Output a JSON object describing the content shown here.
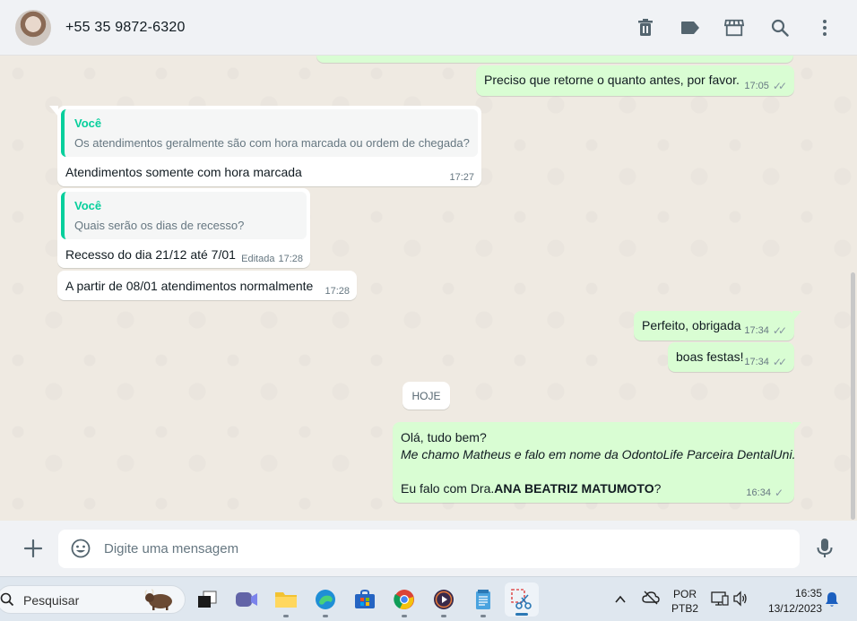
{
  "header": {
    "contact_name": "+55 35 9872-6320",
    "icons": [
      "delete-icon",
      "label-icon",
      "store-icon",
      "search-icon",
      "menu-icon"
    ]
  },
  "messages": {
    "m1": {
      "text": "Preciso que retorne o quanto antes, por favor.",
      "time": "17:05",
      "status": "read"
    },
    "m2": {
      "quote_author": "Você",
      "quote_text": "Os atendimentos geralmente são com hora marcada ou ordem de chegada?",
      "text": "Atendimentos somente com hora marcada",
      "time": "17:27"
    },
    "m3": {
      "quote_author": "Você",
      "quote_text": "Quais serão os dias de recesso?",
      "text": "Recesso do dia 21/12 até 7/01",
      "edited": "Editada",
      "time": "17:28"
    },
    "m4": {
      "text": "A partir de 08/01 atendimentos normalmente",
      "time": "17:28"
    },
    "m5": {
      "text": "Perfeito, obrigada",
      "time": "17:34",
      "status": "read"
    },
    "m6": {
      "text": "boas festas!",
      "time": "17:34",
      "status": "read"
    },
    "date_divider": "HOJE",
    "m7": {
      "line1": "Olá, tudo bem?",
      "line2": "Me chamo Matheus e falo em nome da OdontoLife Parceira DentalUni.",
      "line3_prefix": "Eu falo com Dra.",
      "line3_bold": "ANA BEATRIZ MATUMOTO",
      "line3_suffix": "?",
      "time": "16:34",
      "status": "sent"
    }
  },
  "composer": {
    "placeholder": "Digite uma mensagem"
  },
  "taskbar": {
    "search_label": "Pesquisar",
    "language_line1": "POR",
    "language_line2": "PTB2",
    "clock_time": "16:35",
    "clock_date": "13/12/2023"
  },
  "colors": {
    "outgoing_bubble": "#d9fdd3",
    "incoming_bubble": "#ffffff",
    "quote_accent": "#06cf9c",
    "chat_background": "#efeae2"
  }
}
